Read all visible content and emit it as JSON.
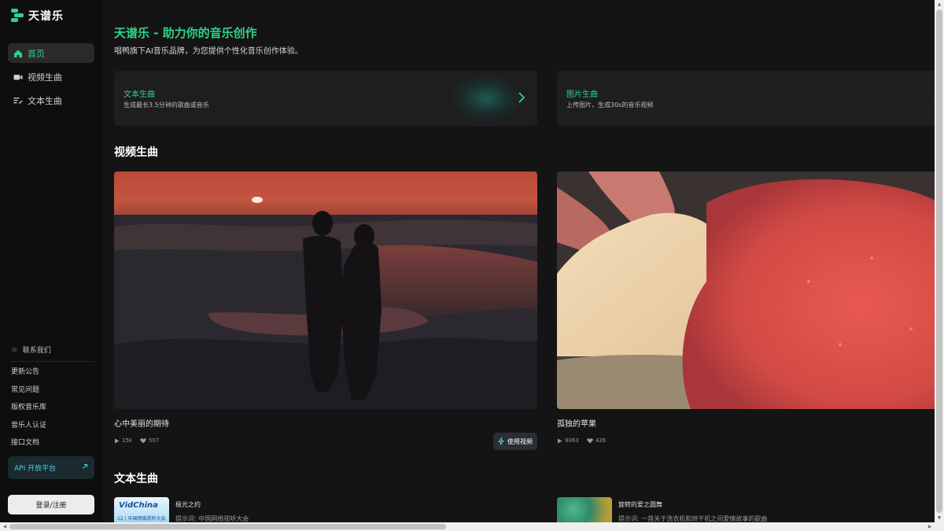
{
  "app": {
    "logo_text": "天谱乐",
    "brand_color": "#2fd28a"
  },
  "sidebar": {
    "nav": [
      {
        "label": "首页",
        "icon": "home-icon",
        "active": true
      },
      {
        "label": "视频生曲",
        "icon": "video-camera-icon",
        "active": false
      },
      {
        "label": "文本生曲",
        "icon": "text-edit-icon",
        "active": false
      }
    ],
    "contact_label": "联系我们",
    "links": [
      "更新公告",
      "常见问题",
      "版权音乐库",
      "音乐人认证",
      "接口文档"
    ],
    "api_label": "API 开放平台",
    "login_label": "登录/注册"
  },
  "hero": {
    "title": "天谱乐 - 助力你的音乐创作",
    "subtitle": "唱鸭旗下AI音乐品牌，为您提供个性化音乐创作体验。"
  },
  "features": [
    {
      "title": "文本生曲",
      "desc": "生成最长3.5分钟的歌曲或音乐"
    },
    {
      "title": "图片生曲",
      "desc": "上传图片，生成30s的音乐视频"
    }
  ],
  "video_section": {
    "title": "视频生曲",
    "cards": [
      {
        "title": "心中美丽的期待",
        "plays": "15k",
        "likes": "507",
        "use_label": "使用视频"
      },
      {
        "title": "孤独的苹果",
        "plays": "9063",
        "likes": "426"
      }
    ]
  },
  "text_section": {
    "title": "文本生曲",
    "items": [
      {
        "name": "极光之约",
        "prompt": "提示词: 中国网络视听大会",
        "thumb_text": "VidChina",
        "thumb_sub": "12 | 中国网络视听大会"
      },
      {
        "name": "旋转的爱之圆舞",
        "prompt": "提示词: 一首关于洗衣机和烘干机之间爱情故事的歌曲"
      }
    ]
  }
}
